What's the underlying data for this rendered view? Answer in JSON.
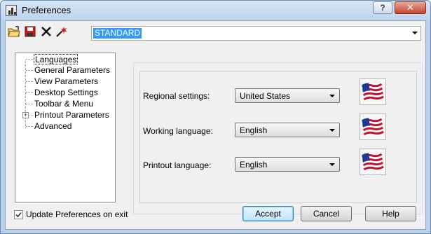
{
  "window": {
    "title": "Preferences",
    "help_button": "?",
    "close_button": "✕"
  },
  "toolbar": {
    "profile_value": "STANDARD",
    "icons": [
      "open-folder-icon",
      "save-icon",
      "delete-icon",
      "new-icon"
    ]
  },
  "tree": {
    "items": [
      {
        "label": "Languages",
        "selected": true
      },
      {
        "label": "General Parameters"
      },
      {
        "label": "View Parameters"
      },
      {
        "label": "Desktop Settings"
      },
      {
        "label": "Toolbar & Menu"
      },
      {
        "label": "Printout Parameters",
        "expandable": true
      },
      {
        "label": "Advanced"
      }
    ],
    "expander_glyph": "+"
  },
  "languages": {
    "regional_label": "Regional settings:",
    "regional_value": "United States",
    "working_label": "Working language:",
    "working_value": "English",
    "printout_label": "Printout language:",
    "printout_value": "English",
    "flag_icon": "us-flag-icon"
  },
  "footer": {
    "update_checkbox_label": "Update Preferences on exit",
    "update_checked": true,
    "accept_label": "Accept",
    "cancel_label": "Cancel",
    "help_label": "Help"
  },
  "colors": {
    "window_frame": "#b9d1ea",
    "selection": "#3399ff",
    "close_button": "#c7462e"
  }
}
